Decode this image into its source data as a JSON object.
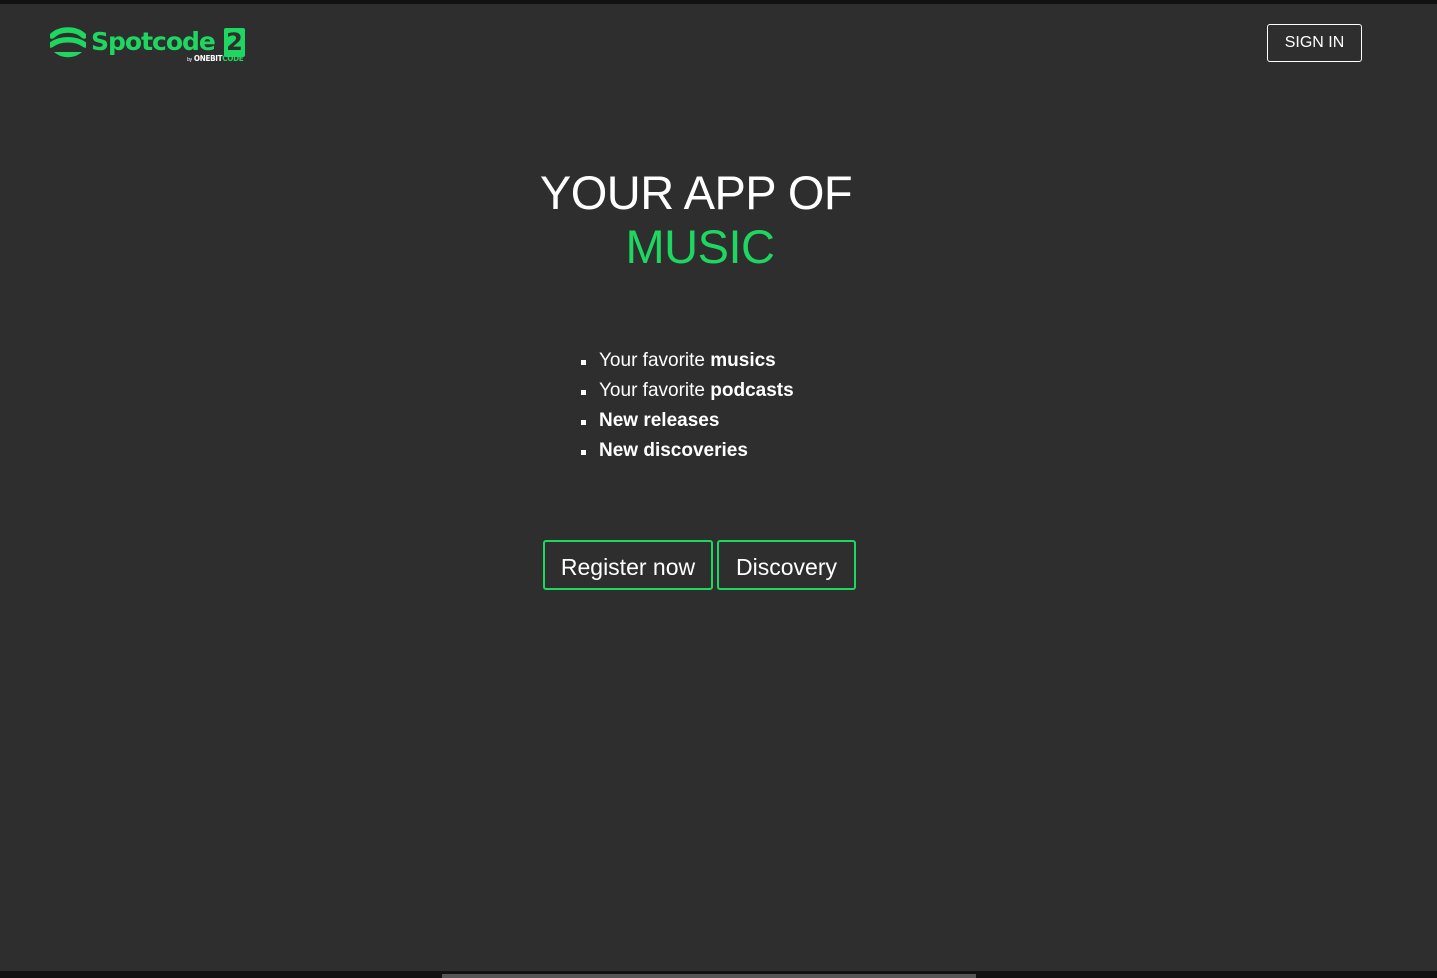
{
  "brand": {
    "name": "Spotcode",
    "version": "2",
    "by": "by",
    "company_left": "ONEBIT",
    "company_right": "CODE",
    "accent_color": "#1ed760"
  },
  "header": {
    "signin_label": "SIGN IN"
  },
  "hero": {
    "title_line1": "YOUR APP OF",
    "title_line2": "MUSIC"
  },
  "features": [
    {
      "prefix": "Your favorite ",
      "bold": "musics"
    },
    {
      "prefix": "Your favorite ",
      "bold": "podcasts"
    },
    {
      "prefix": "",
      "bold": "New releases"
    },
    {
      "prefix": "",
      "bold": "New discoveries"
    }
  ],
  "actions": {
    "register_label": "Register now",
    "discovery_label": "Discovery"
  },
  "colors": {
    "background": "#2e2e2e",
    "text": "#ffffff",
    "accent": "#1ed760"
  }
}
